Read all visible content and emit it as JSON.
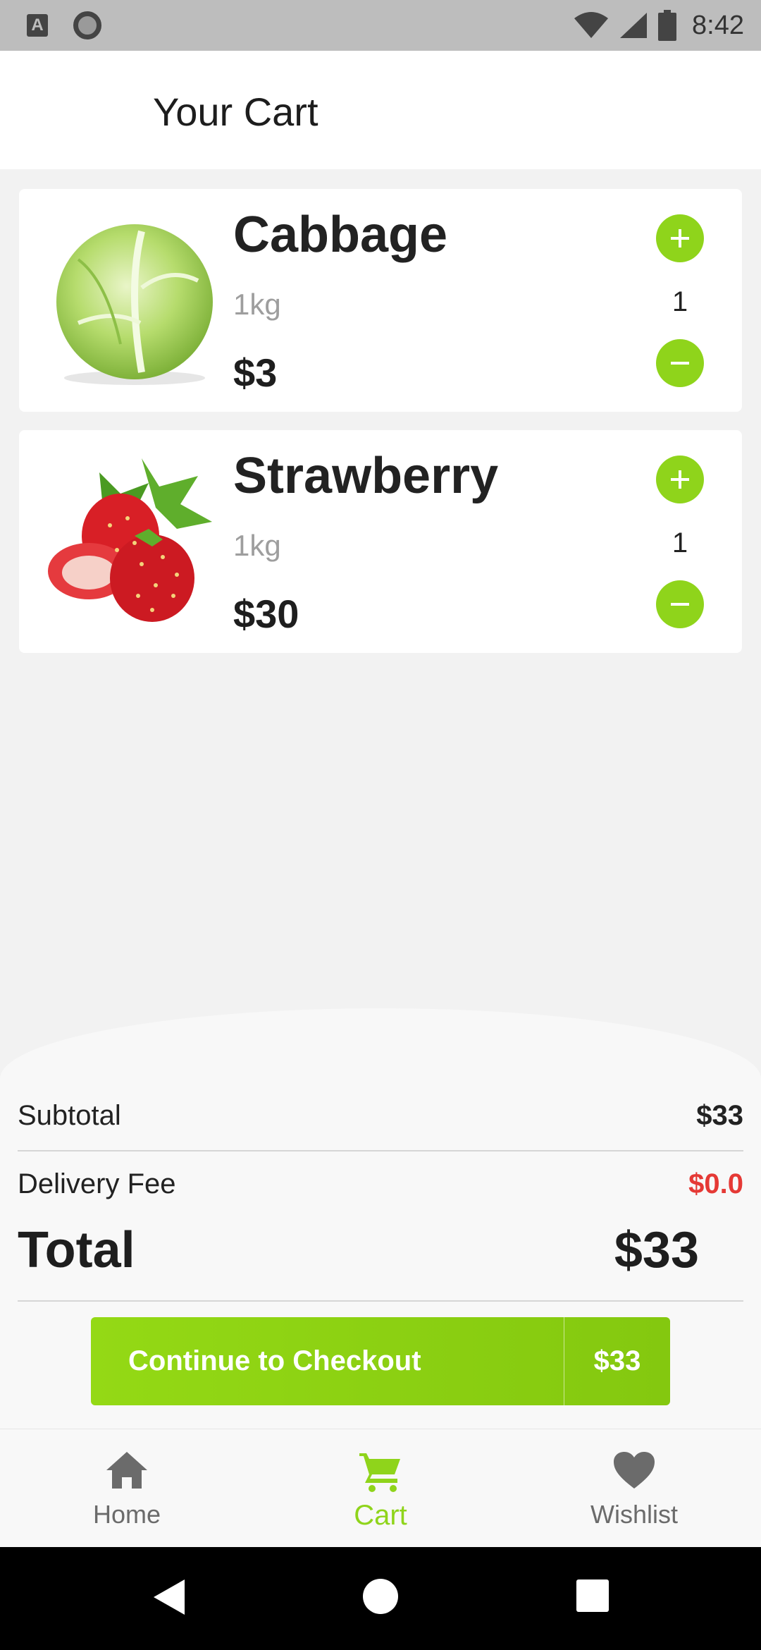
{
  "status_bar": {
    "time": "8:42",
    "notification_icon_letter": "A"
  },
  "app_bar": {
    "title": "Your Cart"
  },
  "cart": {
    "items": [
      {
        "name": "Cabbage",
        "weight": "1kg",
        "price": "$3",
        "quantity": "1",
        "image": "cabbage-image"
      },
      {
        "name": "Strawberry",
        "weight": "1kg",
        "price": "$30",
        "quantity": "1",
        "image": "strawberry-image"
      }
    ]
  },
  "summary": {
    "subtotal_label": "Subtotal",
    "subtotal_value": "$33",
    "delivery_label": "Delivery Fee",
    "delivery_value": "$0.0",
    "total_label": "Total",
    "total_value": "$33"
  },
  "checkout": {
    "label": "Continue to Checkout",
    "price": "$33"
  },
  "bottom_nav": {
    "items": [
      {
        "label": "Home",
        "icon": "home-icon",
        "active": false
      },
      {
        "label": "Cart",
        "icon": "cart-icon",
        "active": true
      },
      {
        "label": "Wishlist",
        "icon": "heart-icon",
        "active": false
      }
    ]
  },
  "colors": {
    "accent": "#8fd41b",
    "delivery_fee": "#e53935",
    "muted_text": "#9e9e9e"
  }
}
